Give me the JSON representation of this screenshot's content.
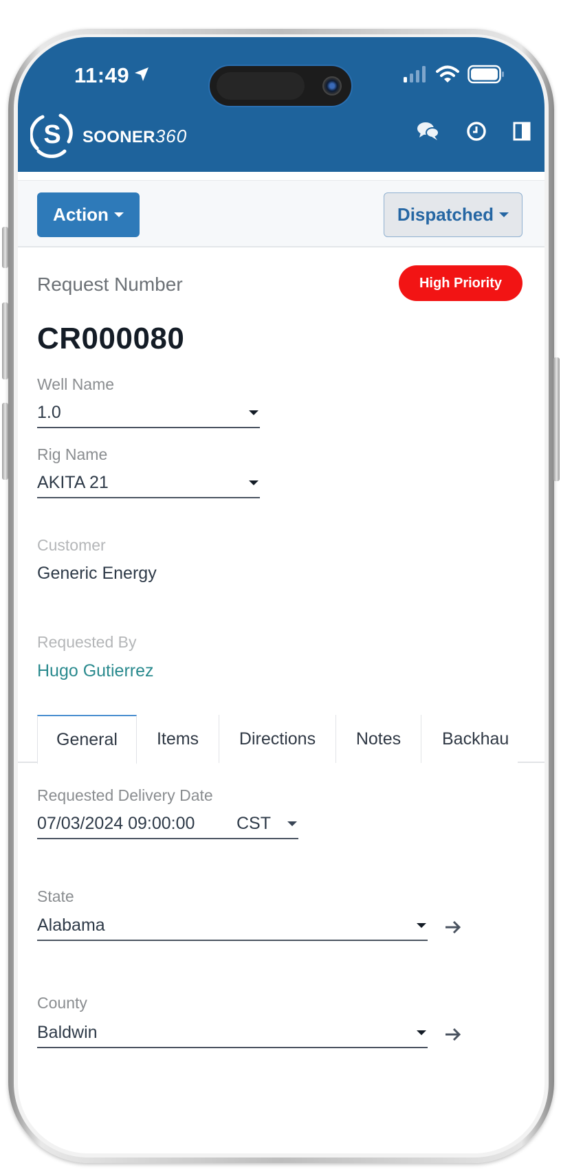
{
  "status_bar": {
    "time": "11:49",
    "location_icon": "location-arrow-icon",
    "signal_icon": "cellular-signal-icon",
    "wifi_icon": "wifi-icon",
    "battery_icon": "battery-icon"
  },
  "header": {
    "brand_name": "SOONER",
    "brand_number": "360",
    "logo_icon": "sooner-logo-icon",
    "icons": [
      "chat-icon",
      "clock-icon",
      "sidebar-panel-icon"
    ],
    "background_color": "#1e639c"
  },
  "toolbar": {
    "action_label": "Action",
    "status_label": "Dispatched"
  },
  "request": {
    "number_label": "Request Number",
    "priority_badge": "High Priority",
    "priority_color": "#f21414",
    "number": "CR000080",
    "well_name_label": "Well Name",
    "well_name_value": "1.0",
    "rig_name_label": "Rig Name",
    "rig_name_value": "AKITA 21",
    "customer_label": "Customer",
    "customer_value": "Generic Energy",
    "requested_by_label": "Requested By",
    "requested_by_value": "Hugo Gutierrez"
  },
  "tabs": [
    {
      "label": "General",
      "active": true
    },
    {
      "label": "Items",
      "active": false
    },
    {
      "label": "Directions",
      "active": false
    },
    {
      "label": "Notes",
      "active": false
    },
    {
      "label": "Backhau",
      "active": false
    }
  ],
  "general": {
    "delivery_date_label": "Requested Delivery Date",
    "delivery_date_value": "07/03/2024 09:00:00",
    "timezone_value": "CST",
    "state_label": "State",
    "state_value": "Alabama",
    "county_label": "County",
    "county_value": "Baldwin"
  }
}
